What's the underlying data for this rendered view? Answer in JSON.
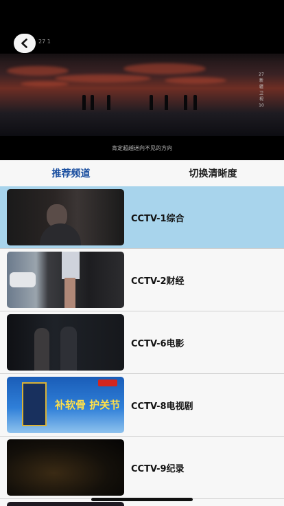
{
  "player": {
    "logo_text": "27 1",
    "vertical_caption": "27 新 疆 卫 视 10",
    "subtitle": "肯定超越迷向不见的方向"
  },
  "tabs": [
    {
      "label": "推荐频道",
      "active": true
    },
    {
      "label": "切换清晰度",
      "active": false
    }
  ],
  "channels": [
    {
      "label": "CCTV-1综合",
      "selected": true,
      "thumb": "drama-scene"
    },
    {
      "label": "CCTV-2财经",
      "selected": false,
      "thumb": "fashion-scene"
    },
    {
      "label": "CCTV-6电影",
      "selected": false,
      "thumb": "movie-scene"
    },
    {
      "label": "CCTV-8电视剧",
      "selected": false,
      "thumb": "advertisement",
      "thumb_text": "补软骨 护关节"
    },
    {
      "label": "CCTV-9纪录",
      "selected": false,
      "thumb": "documentary-scene"
    }
  ],
  "icons": {
    "back": "chevron-left-icon"
  },
  "colors": {
    "accent": "#1b4fa0",
    "selected_row": "#a8d4ec",
    "background": "#f7f7f7"
  }
}
